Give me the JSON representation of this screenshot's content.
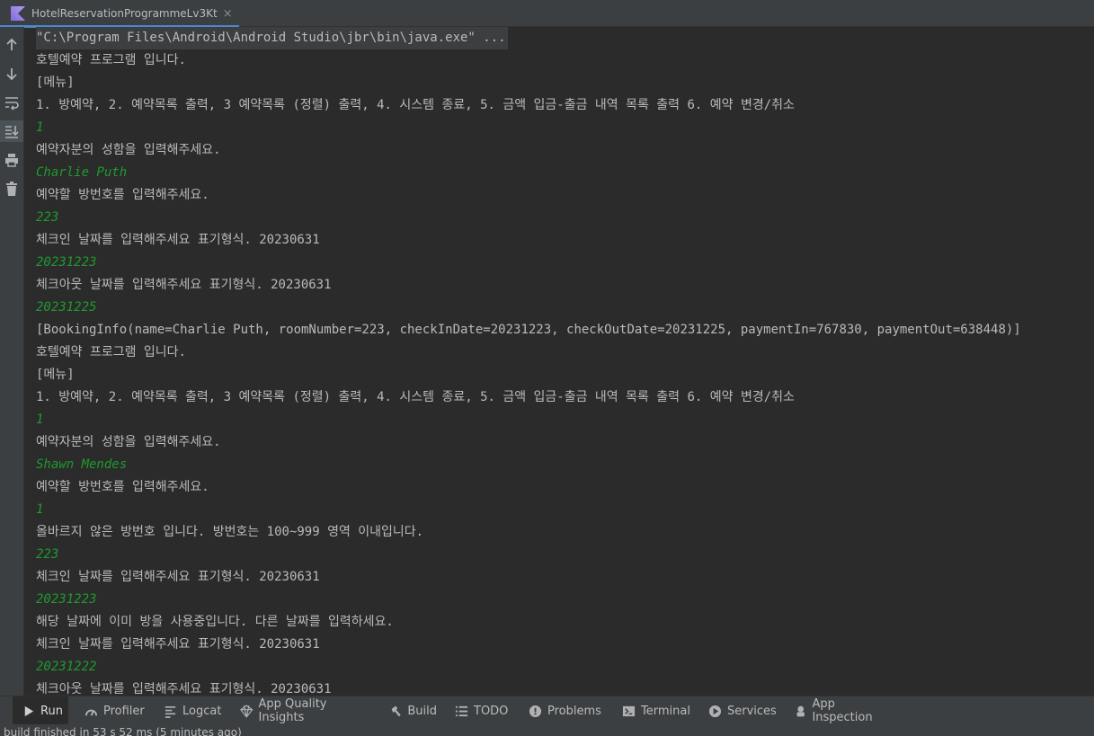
{
  "tab": {
    "title": "HotelReservationProgrammeLv3Kt",
    "close": "×"
  },
  "tools": [
    "up-arrow-icon",
    "down-arrow-icon",
    "soft-wrap-icon",
    "scroll-to-end-icon",
    "print-icon",
    "trash-icon"
  ],
  "console": {
    "lines": [
      {
        "text": "\"C:\\Program Files\\Android\\Android Studio\\jbr\\bin\\java.exe\" ...",
        "kind": "cmd"
      },
      {
        "text": "호텔예약 프로그램 입니다.",
        "kind": "out"
      },
      {
        "text": "[메뉴]",
        "kind": "out"
      },
      {
        "text": "1. 방예약, 2. 예약목록 출력, 3 예약목록 (정렬) 출력, 4. 시스템 종료, 5. 금액 입금-출금 내역 목록 출력 6. 예약 변경/취소",
        "kind": "out"
      },
      {
        "text": "1",
        "kind": "input"
      },
      {
        "text": "예약자분의 성함을 입력해주세요.",
        "kind": "out"
      },
      {
        "text": "Charlie Puth",
        "kind": "input"
      },
      {
        "text": "예약할 방번호를 입력해주세요.",
        "kind": "out"
      },
      {
        "text": "223",
        "kind": "input"
      },
      {
        "text": "체크인 날짜를 입력해주세요 표기형식. 20230631",
        "kind": "out"
      },
      {
        "text": "20231223",
        "kind": "input"
      },
      {
        "text": "체크아웃 날짜를 입력해주세요 표기형식. 20230631",
        "kind": "out"
      },
      {
        "text": "20231225",
        "kind": "input"
      },
      {
        "text": "[BookingInfo(name=Charlie Puth, roomNumber=223, checkInDate=20231223, checkOutDate=20231225, paymentIn=767830, paymentOut=638448)]",
        "kind": "out"
      },
      {
        "text": "호텔예약 프로그램 입니다.",
        "kind": "out"
      },
      {
        "text": "[메뉴]",
        "kind": "out"
      },
      {
        "text": "1. 방예약, 2. 예약목록 출력, 3 예약목록 (정렬) 출력, 4. 시스템 종료, 5. 금액 입금-출금 내역 목록 출력 6. 예약 변경/취소",
        "kind": "out"
      },
      {
        "text": "1",
        "kind": "input"
      },
      {
        "text": "예약자분의 성함을 입력해주세요.",
        "kind": "out"
      },
      {
        "text": "Shawn Mendes",
        "kind": "input"
      },
      {
        "text": "예약할 방번호를 입력해주세요.",
        "kind": "out"
      },
      {
        "text": "1",
        "kind": "input"
      },
      {
        "text": "올바르지 않은 방번호 입니다. 방번호는 100~999 영역 이내입니다.",
        "kind": "out"
      },
      {
        "text": "223",
        "kind": "input"
      },
      {
        "text": "체크인 날짜를 입력해주세요 표기형식. 20230631",
        "kind": "out"
      },
      {
        "text": "20231223",
        "kind": "input"
      },
      {
        "text": "해당 날짜에 이미 방을 사용중입니다. 다른 날짜를 입력하세요.",
        "kind": "out"
      },
      {
        "text": "체크인 날짜를 입력해주세요 표기형식. 20230631",
        "kind": "out"
      },
      {
        "text": "20231222",
        "kind": "input"
      },
      {
        "text": "체크아웃 날짜를 입력해주세요 표기형식. 20230631",
        "kind": "out"
      }
    ]
  },
  "bottom_tabs": [
    {
      "label": "Run",
      "icon": "play-icon",
      "active": true
    },
    {
      "label": "Profiler",
      "icon": "gauge-icon"
    },
    {
      "label": "Logcat",
      "icon": "logcat-icon"
    },
    {
      "label": "App Quality Insights",
      "icon": "diamond-icon"
    },
    {
      "label": "Build",
      "icon": "hammer-icon"
    },
    {
      "label": "TODO",
      "icon": "list-icon"
    },
    {
      "label": "Problems",
      "icon": "info-icon"
    },
    {
      "label": "Terminal",
      "icon": "terminal-icon"
    },
    {
      "label": "Services",
      "icon": "services-icon"
    },
    {
      "label": "App Inspection",
      "icon": "inspection-icon"
    }
  ],
  "status": {
    "text": "build finished in 53 s 52 ms (5 minutes ago)"
  },
  "colors": {
    "background": "#2b2b2b",
    "output": "#bababa",
    "input": "#1e9a2e",
    "accent": "#4a88c7"
  }
}
